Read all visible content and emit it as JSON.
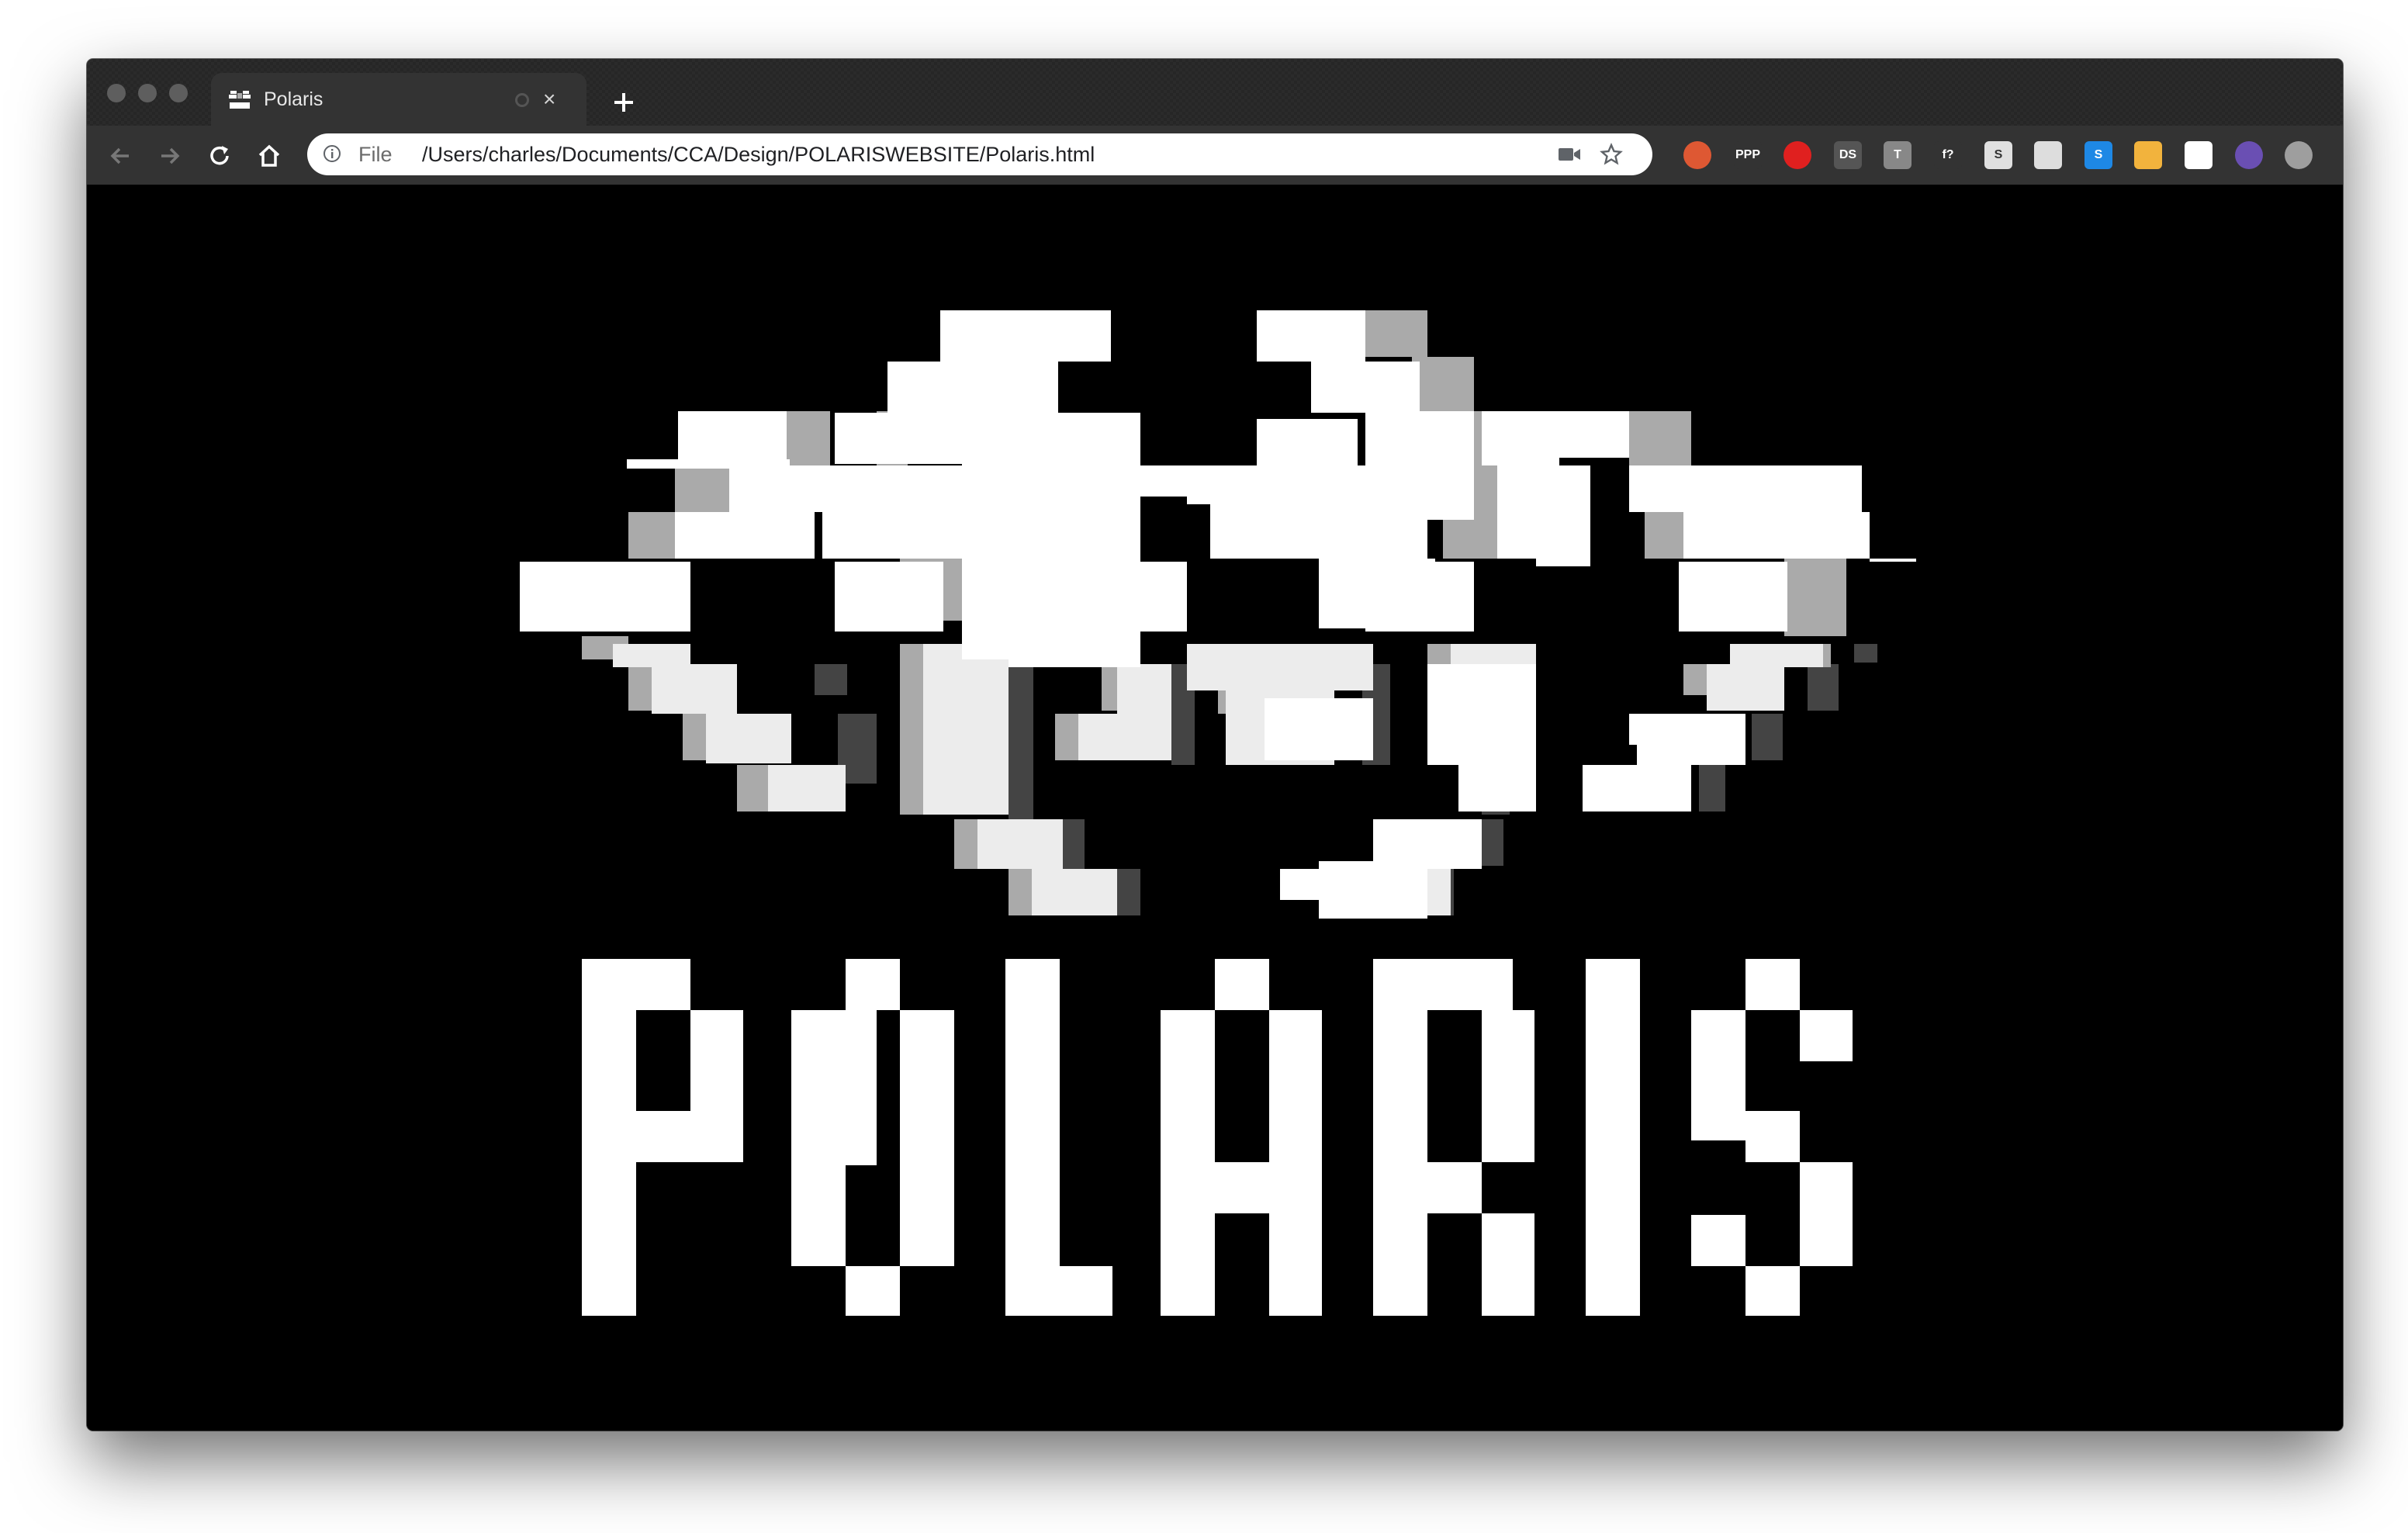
{
  "window": {
    "traffic_lights": [
      "close",
      "minimize",
      "zoom"
    ]
  },
  "tab": {
    "title": "Polaris",
    "favicon_icon": "polaris-logo-icon",
    "close_label": "×"
  },
  "toolbar": {
    "back_icon": "arrow-left-icon",
    "forward_icon": "arrow-right-icon",
    "reload_icon": "reload-icon",
    "home_icon": "home-icon",
    "omnibox": {
      "scheme_label": "File",
      "url": "/Users/charles/Documents/CCA/Design/POLARISWEBSITE/Polaris.html",
      "icons": [
        "info-icon",
        "camera-icon",
        "star-icon"
      ]
    },
    "extensions": [
      {
        "name": "duckduckgo-icon",
        "color": "#de5833",
        "text": ""
      },
      {
        "name": "ppp-icon",
        "color": "#333333",
        "text": "PPP"
      },
      {
        "name": "adblock-icon",
        "color": "#e0201f",
        "text": ""
      },
      {
        "name": "ds-icon",
        "color": "#555555",
        "text": "DS"
      },
      {
        "name": "t-icon",
        "color": "#888888",
        "text": "T"
      },
      {
        "name": "font-question-icon",
        "color": "#333333",
        "text": "f?"
      },
      {
        "name": "s-icon",
        "color": "#e0e0e0",
        "text": "S"
      },
      {
        "name": "columns-icon",
        "color": "#dddddd",
        "text": ""
      },
      {
        "name": "skype-icon",
        "color": "#1e88e5",
        "text": "S"
      },
      {
        "name": "lips-icon",
        "color": "#f2b33d",
        "text": ""
      },
      {
        "name": "fonts-icon",
        "color": "#ffffff",
        "text": ""
      },
      {
        "name": "avatar-icon",
        "color": "#6a4fb3",
        "text": ""
      },
      {
        "name": "update-icon",
        "color": "#9e9e9e",
        "text": ""
      }
    ]
  },
  "page": {
    "wordmark": "POLARIS",
    "colors": {
      "background": "#000000",
      "primary": "#ffffff",
      "secondary": "#aaaaaa",
      "light": "#ececec",
      "dark": "#444444"
    }
  }
}
